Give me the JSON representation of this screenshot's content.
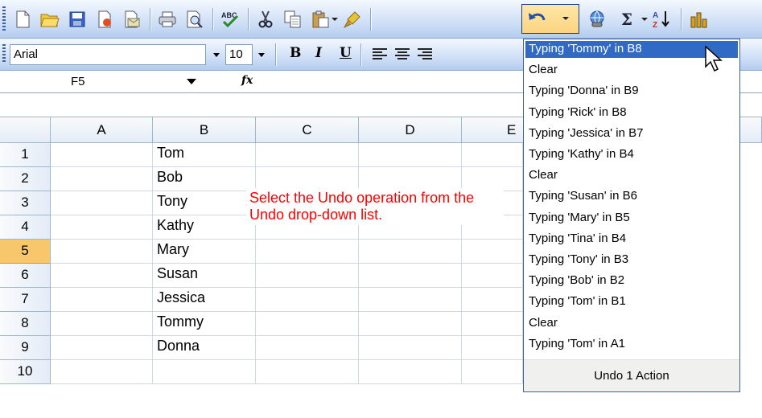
{
  "toolbar_standard": {
    "icons": [
      "new-icon",
      "open-icon",
      "save-icon",
      "permission-icon",
      "email-icon",
      "print-icon",
      "print-preview-icon",
      "spelling-icon",
      "cut-icon",
      "copy-icon",
      "paste-icon",
      "format-painter-icon",
      "undo-icon",
      "hyperlink-icon",
      "autosum-icon",
      "sort-ascending-icon",
      "chart-wizard-icon"
    ],
    "autosum_glyph": "Σ",
    "sort_glyph": "A↓Z"
  },
  "toolbar_formatting": {
    "font_name": "Arial",
    "font_size": "10",
    "bold": "B",
    "italic": "I",
    "underline": "U"
  },
  "formula_bar": {
    "name_box": "F5",
    "fx": "fx",
    "formula": ""
  },
  "sheet": {
    "columns": [
      "A",
      "B",
      "C",
      "D",
      "E"
    ],
    "rows": [
      "1",
      "2",
      "3",
      "4",
      "5",
      "6",
      "7",
      "8",
      "9",
      "10"
    ],
    "active_row": "5",
    "column_b": [
      "Tom",
      "Bob",
      "Tony",
      "Kathy",
      "Mary",
      "Susan",
      "Jessica",
      "Tommy",
      "Donna",
      ""
    ]
  },
  "annotation": {
    "text": "Select the Undo operation from the Undo drop-down list."
  },
  "undo_dropdown": {
    "items": [
      "Typing 'Tommy' in B8",
      "Clear",
      "Typing 'Donna' in B9",
      "Typing 'Rick' in B8",
      "Typing 'Jessica' in B7",
      "Typing 'Kathy' in B4",
      "Clear",
      "Typing 'Susan' in B6",
      "Typing 'Mary' in B5",
      "Typing 'Tina' in B4",
      "Typing 'Tony' in B3",
      "Typing 'Bob' in B2",
      "Typing 'Tom' in B1",
      "Clear",
      "Typing 'Tom' in A1"
    ],
    "highlighted_index": 0,
    "footer": "Undo 1 Action"
  },
  "colors": {
    "annotation": "#ff0000",
    "highlight": "#316ac5",
    "active_header": "#f9c76b"
  }
}
